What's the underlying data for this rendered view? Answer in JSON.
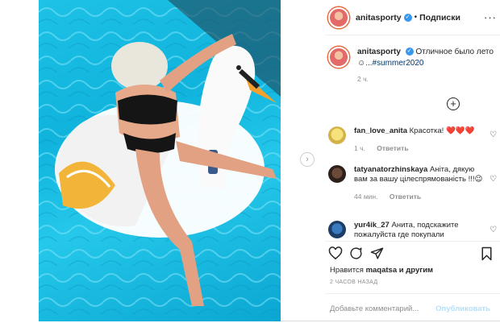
{
  "post": {
    "username": "anitasporty",
    "follow_label": "Подписки",
    "caption_text": "Отличное было лето",
    "caption_ellipsis": "☺...",
    "caption_hashtag": "#summer2020",
    "caption_time": "2 ч.",
    "add_icon": "plus-circle-icon"
  },
  "comments": [
    {
      "user": "fan_love_anita",
      "text": "Красотка! ❤️❤️❤️",
      "time": "1 ч.",
      "reply": "Ответить"
    },
    {
      "user": "tatyanatorzhinskaya",
      "text": "Аніта, дякую вам за вашу цілеспрямованість !!!😉",
      "time": "44 мин.",
      "reply": "Ответить"
    },
    {
      "user": "yur4ik_27",
      "text": "Анита, подскажите пожалуйста где покупали"
    }
  ],
  "actions": {
    "likes_prefix": "Нравится",
    "likes_user": "maqatsa",
    "likes_suffix": "и другим",
    "posted_ago": "2 ЧАСОВ НАЗАД",
    "comment_placeholder": "Добавьте комментарий...",
    "publish_label": "Опубликовать"
  },
  "colors": {
    "link": "#00376b",
    "verified": "#3897f0",
    "publish_disabled": "#b2dffc",
    "muted": "#8e8e8e"
  }
}
